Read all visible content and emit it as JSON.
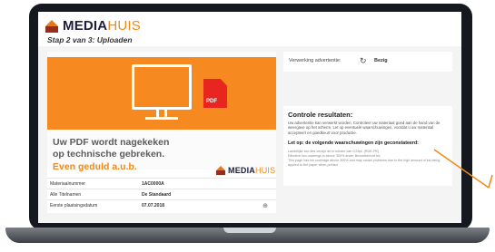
{
  "app": {
    "brand_bold": "MEDIA",
    "brand_thin": "HUIS",
    "step_title": "Stap 2 van 3: Uploaden"
  },
  "hero": {
    "pdf_label": "PDF",
    "line1": "Uw PDF wordt nagekeken",
    "line2": "op technische gebreken.",
    "line3": "Even geduld a.u.b.",
    "brand_bold": "MEDIA",
    "brand_thin": "HUIS"
  },
  "details": {
    "rows": [
      {
        "label": "Materiaalnummer",
        "value": "1AC0000A"
      },
      {
        "label": "Alle Titelnamen",
        "value": "De Standaard"
      },
      {
        "label": "Eerste plaatsingsdatum",
        "value": "07.07.2018"
      }
    ]
  },
  "processing": {
    "label": "Verwerking advertentie:",
    "value": "Bezig"
  },
  "results": {
    "title": "Controle resultaten:",
    "body": "Uw advertentie kan verwerkt worden. Controleer uw materiaal goed aan de hand van de weergave op het scherm. Let op eventuele waarschuwingen, voordat u uw materiaal accepteert en goedkeurt voor productie.",
    "warnings_title": "Let op: de volgende waarschuwingen zijn geconstateerd:",
    "warnings": [
      "Landelijke sec-ties verzijn de in minder van 0,25pt. (RGE-PE)",
      "Effective sec-waarings in above 300% ander Bevoelbericht bic",
      "This page has ink coverage above 300% and may cause problems due to the high amount of ink being applied to the paper when printed"
    ]
  },
  "colors": {
    "accent": "#f08a17",
    "hero_orange": "#f6891f",
    "brand_dark": "#1e1e3c",
    "pdf_red": "#e8261f"
  },
  "icons": {
    "processing": "refresh-icon",
    "zoom": "magnifier-plus-icon",
    "pdf": "pdf-file-icon",
    "monitor": "monitor-icon"
  }
}
